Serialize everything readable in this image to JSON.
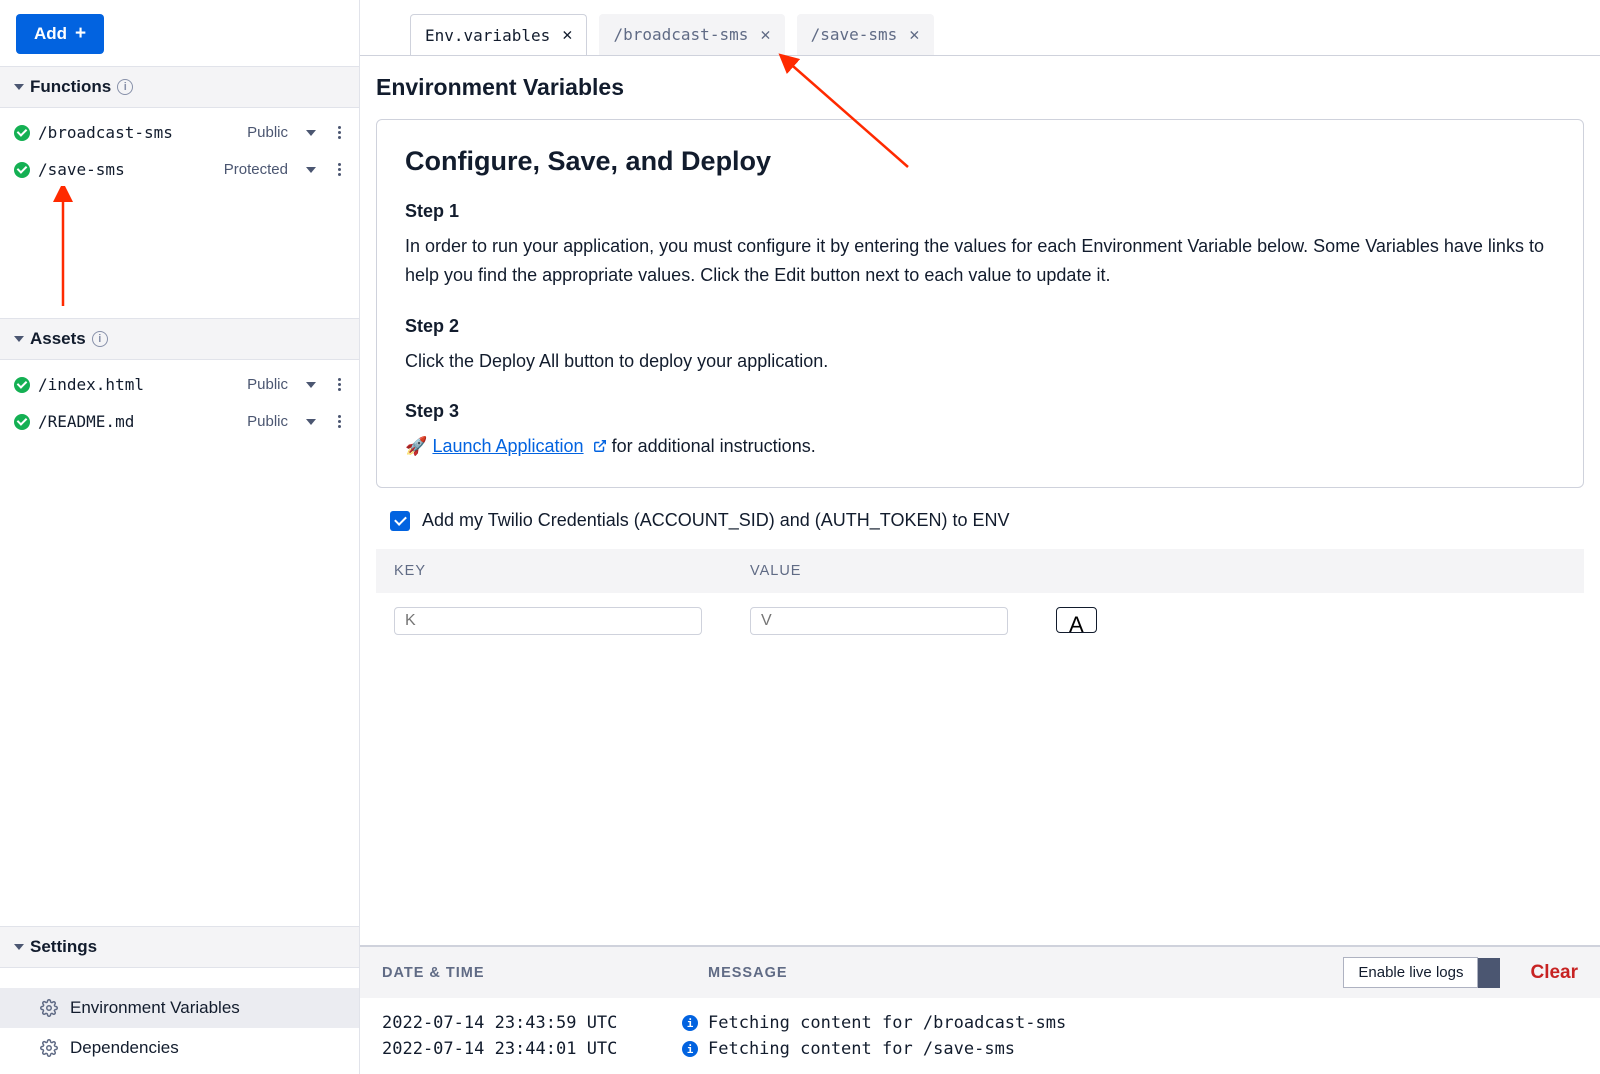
{
  "sidebar": {
    "add_label": "Add",
    "functions": {
      "title": "Functions",
      "items": [
        {
          "name": "/broadcast-sms",
          "visibility": "Public"
        },
        {
          "name": "/save-sms",
          "visibility": "Protected"
        }
      ]
    },
    "assets": {
      "title": "Assets",
      "items": [
        {
          "name": "/index.html",
          "visibility": "Public"
        },
        {
          "name": "/README.md",
          "visibility": "Public"
        }
      ]
    },
    "settings": {
      "title": "Settings",
      "items": [
        {
          "label": "Environment Variables"
        },
        {
          "label": "Dependencies"
        }
      ]
    }
  },
  "tabs": [
    {
      "label": "Env.variables",
      "active": true
    },
    {
      "label": "/broadcast-sms",
      "active": false
    },
    {
      "label": "/save-sms",
      "active": false
    }
  ],
  "page": {
    "heading": "Environment Variables",
    "card": {
      "title": "Configure, Save, and Deploy",
      "steps": [
        {
          "title": "Step 1",
          "text": "In order to run your application, you must configure it by entering the values for each Environment Variable below. Some Variables have links to help you find the appropriate values. Click the Edit button next to each value to update it."
        },
        {
          "title": "Step 2",
          "text": "Click the Deploy All button to deploy your application."
        },
        {
          "title": "Step 3",
          "link_text": "Launch Application",
          "after_link": "  for additional instructions.",
          "rocket": "🚀"
        }
      ]
    },
    "credentials_label": "Add my Twilio Credentials (ACCOUNT_SID) and (AUTH_TOKEN) to ENV",
    "table": {
      "key_header": "KEY",
      "value_header": "VALUE",
      "key_placeholder": "K",
      "value_placeholder": "V",
      "add_label": "A"
    }
  },
  "logs": {
    "dt_header": "DATE & TIME",
    "msg_header": "MESSAGE",
    "live_label": "Enable live logs",
    "clear_label": "Clear",
    "rows": [
      {
        "dt": "2022-07-14 23:43:59 UTC",
        "msg": "Fetching content for /broadcast-sms"
      },
      {
        "dt": "2022-07-14 23:44:01 UTC",
        "msg": "Fetching content for /save-sms"
      }
    ]
  }
}
